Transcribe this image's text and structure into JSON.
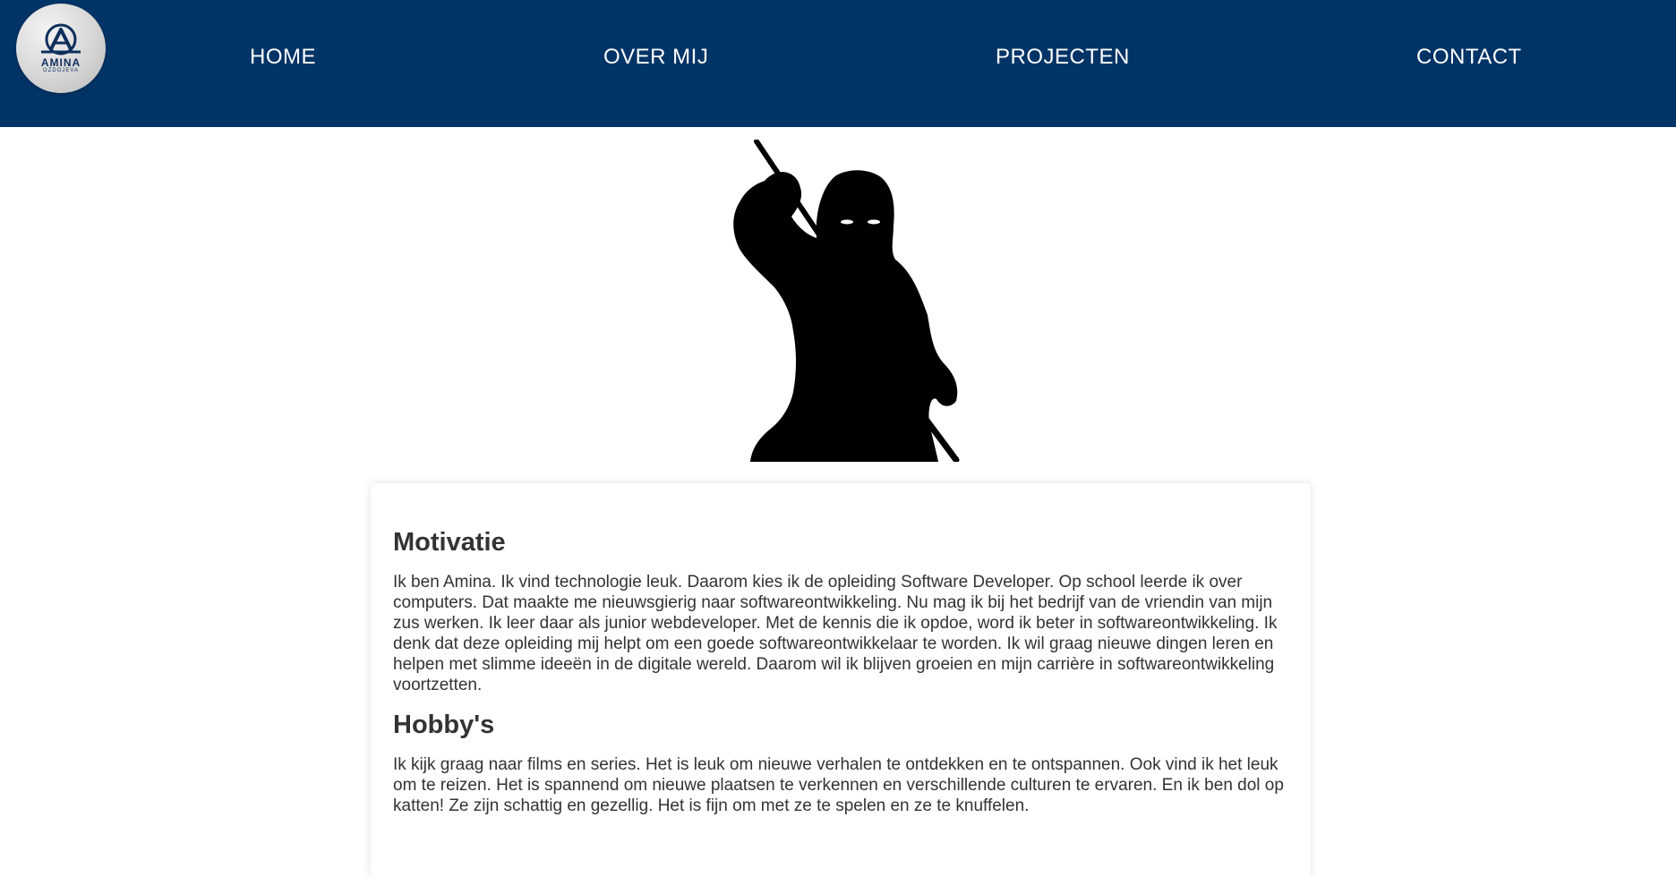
{
  "logo": {
    "name": "AMINA",
    "surname": "OZDOJEVA",
    "icon": "letter-a-emblem-icon"
  },
  "nav": {
    "home": "HOME",
    "about": "OVER MIJ",
    "projects": "PROJECTEN",
    "contact": "CONTACT"
  },
  "hero": {
    "image": "ninja-silhouette-icon"
  },
  "sections": [
    {
      "title": "Motivatie",
      "text": "Ik ben Amina. Ik vind technologie leuk. Daarom kies ik de opleiding Software Developer. Op school leerde ik over computers. Dat maakte me nieuwsgierig naar softwareontwikkeling. Nu mag ik bij het bedrijf van de vriendin van mijn zus werken. Ik leer daar als junior webdeveloper. Met de kennis die ik opdoe, word ik beter in softwareontwikkeling. Ik denk dat deze opleiding mij helpt om een goede softwareontwikkelaar te worden. Ik wil graag nieuwe dingen leren en helpen met slimme ideeën in de digitale wereld. Daarom wil ik blijven groeien en mijn carrière in softwareontwikkeling voortzetten."
    },
    {
      "title": "Hobby's",
      "text": "Ik kijk graag naar films en series. Het is leuk om nieuwe verhalen te ontdekken en te ontspannen. Ook vind ik het leuk om te reizen. Het is spannend om nieuwe plaatsen te verkennen en verschillende culturen te ervaren. En ik ben dol op katten! Ze zijn schattig en gezellig. Het is fijn om met ze te spelen en ze te knuffelen."
    }
  ],
  "colors": {
    "navbar": "#003366",
    "nav_text": "#ffffff",
    "body_text": "#333333"
  }
}
